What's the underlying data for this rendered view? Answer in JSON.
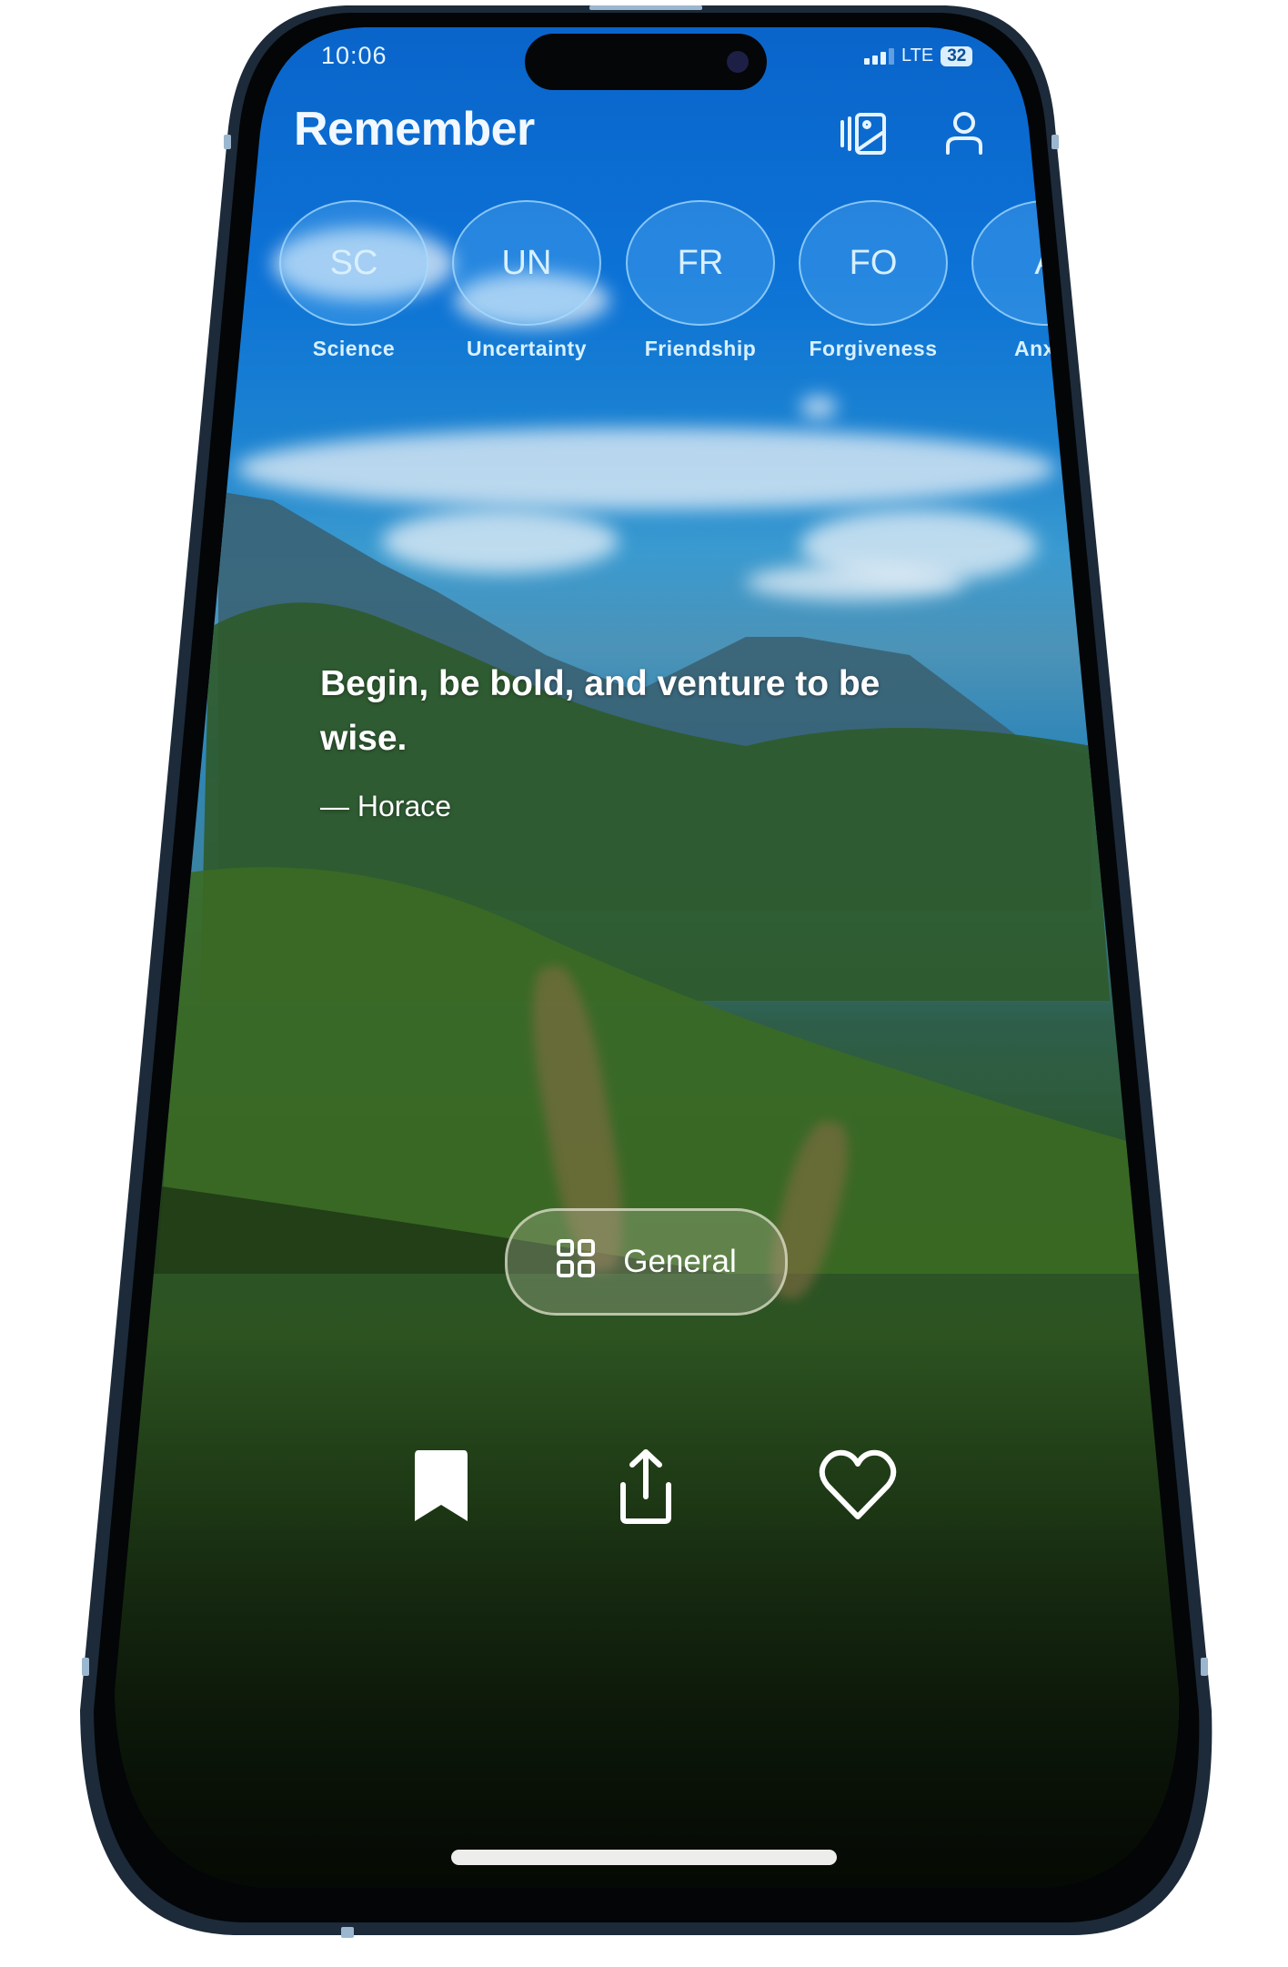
{
  "status_bar": {
    "time": "10:06",
    "network": "LTE",
    "battery": "32"
  },
  "header": {
    "title": "Remember",
    "icons": [
      "gallery-icon",
      "profile-icon"
    ]
  },
  "topics": [
    {
      "abbr": "SC",
      "label": "Science"
    },
    {
      "abbr": "UN",
      "label": "Uncertainty"
    },
    {
      "abbr": "FR",
      "label": "Friendship"
    },
    {
      "abbr": "FO",
      "label": "Forgiveness"
    },
    {
      "abbr": "A",
      "label": "Anx"
    }
  ],
  "quote": {
    "text": "Begin, be bold, and venture to be wise.",
    "author": "— Horace"
  },
  "category": {
    "icon": "grid-icon",
    "label": "General"
  },
  "actions": [
    {
      "name": "bookmark",
      "icon": "bookmark-icon"
    },
    {
      "name": "share",
      "icon": "share-icon"
    },
    {
      "name": "like",
      "icon": "heart-icon"
    }
  ]
}
